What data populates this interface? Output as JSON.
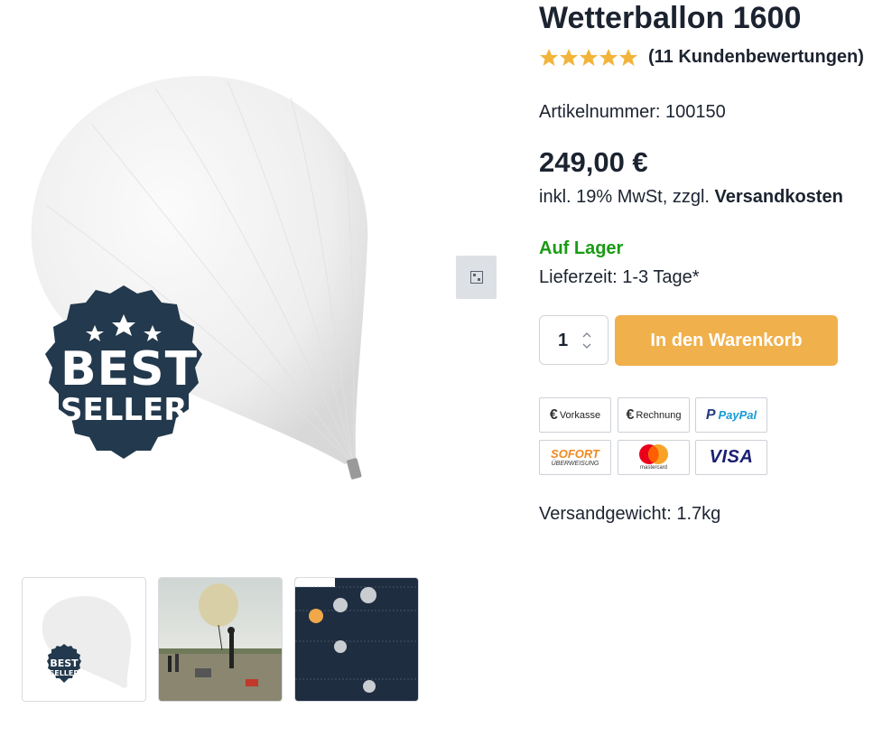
{
  "product": {
    "title": "Wetterballon 1600",
    "rating": {
      "stars": 5,
      "max": 5,
      "text": "(11 Kundenbewertungen)"
    },
    "sku_label": "Artikelnummer: 100150",
    "price": "249,00 €",
    "tax_prefix": "inkl. 19% MwSt, zzgl. ",
    "tax_link": "Versandkosten",
    "stock": "Auf Lager",
    "delivery": "Lieferzeit: 1-3 Tage*",
    "quantity": "1",
    "add_to_cart": "In den Warenkorb",
    "shipping_weight": "Versandgewicht: 1.7kg"
  },
  "badge": {
    "line1": "BEST",
    "line2": "SELLER"
  },
  "payments": [
    {
      "name": "Vorkasse",
      "icon": "euro-icon"
    },
    {
      "name": "Rechnung",
      "icon": "euro-icon"
    },
    {
      "name": "PayPal",
      "icon": "paypal-logo"
    },
    {
      "name": "SOFORT",
      "sub": "ÜBERWEISUNG",
      "icon": "sofort-logo"
    },
    {
      "name": "mastercard",
      "icon": "mastercard-logo"
    },
    {
      "name": "VISA",
      "icon": "visa-logo"
    }
  ],
  "colors": {
    "accent": "#f0b04c",
    "stock": "#1a9b14",
    "badge": "#23394d",
    "star": "#f2b43b",
    "paypal": "#253b80",
    "visa": "#1a1f71"
  }
}
